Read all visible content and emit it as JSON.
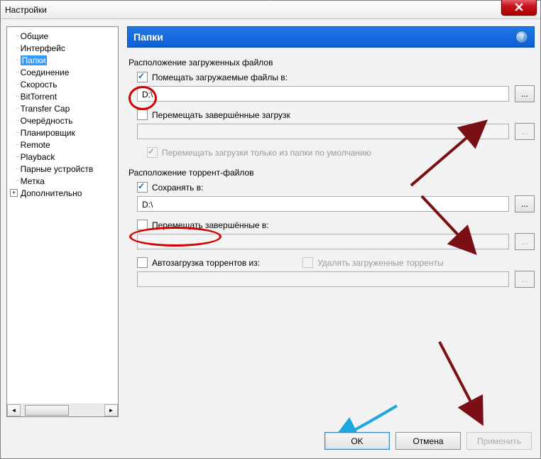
{
  "window": {
    "title": "Настройки"
  },
  "sidebar": {
    "items": [
      {
        "label": "Общие"
      },
      {
        "label": "Интерфейс"
      },
      {
        "label": "Папки",
        "selected": true
      },
      {
        "label": "Соединение"
      },
      {
        "label": "Скорость"
      },
      {
        "label": "BitTorrent"
      },
      {
        "label": "Transfer Cap"
      },
      {
        "label": "Очерёдность"
      },
      {
        "label": "Планировщик"
      },
      {
        "label": "Remote"
      },
      {
        "label": "Playback"
      },
      {
        "label": "Парные устройств"
      },
      {
        "label": "Метка"
      }
    ],
    "expand_label": "Дополнительно"
  },
  "header": {
    "title": "Папки"
  },
  "sections": {
    "downloads_title": "Расположение загруженных файлов",
    "put_new_label": "Помещать загружаемые файлы в:",
    "put_new_path": "D:\\",
    "move_completed_label": "Перемещать завершённые загрузк",
    "move_completed_path": "",
    "only_default_label": "Перемещать загрузки только из папки по умолчанию",
    "torrents_title": "Расположение торрент-файлов",
    "store_in_label": "Сохранять в:",
    "store_in_path": "D:\\",
    "move_torrents_label": "Перемещать завершённые в:",
    "move_torrents_path": "",
    "autoload_label": "Автозагрузка торрентов из:",
    "delete_loaded_label": "Удалять загруженные торренты",
    "autoload_path": ""
  },
  "buttons": {
    "ok": "OK",
    "cancel": "Отмена",
    "apply": "Применить"
  },
  "browse_label": "..."
}
